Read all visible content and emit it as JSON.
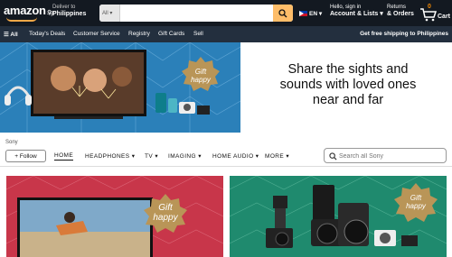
{
  "header": {
    "logo": "amazon",
    "logo_tld": ".sg",
    "deliver_label": "Deliver to",
    "deliver_location": "Philippines",
    "search_category": "All",
    "search_placeholder": "",
    "language": "EN",
    "account_greeting": "Hello, sign in",
    "account_label": "Account & Lists",
    "returns_label": "Returns",
    "orders_label": "& Orders",
    "cart_count": "0",
    "cart_label": "Cart"
  },
  "nav": {
    "all_label": "All",
    "items": [
      "Today's Deals",
      "Customer Service",
      "Registry",
      "Gift Cards",
      "Sell"
    ],
    "promo": "Get free shipping to Philippines"
  },
  "hero": {
    "headline_1": "Share the sights and",
    "headline_2": "sounds with loved ones",
    "headline_3": "near and far",
    "badge_1": "Gift",
    "badge_2": "happy"
  },
  "store": {
    "breadcrumb": "Sony",
    "follow_label": "+ Follow",
    "tabs": [
      "HOME",
      "HEADPHONES",
      "TV",
      "IMAGING",
      "HOME AUDIO",
      "MORE"
    ],
    "search_placeholder": "Search all Sony"
  },
  "tiles": {
    "tile1_badge_1": "Gift",
    "tile1_badge_2": "happy",
    "tile2_badge_1": "Gift",
    "tile2_badge_2": "happy"
  },
  "colors": {
    "topbar": "#131921",
    "navbar": "#232f3e",
    "search_button": "#febd69",
    "hero_blue": "#2b80b9",
    "tile_red": "#c8364a",
    "tile_green": "#1f8a6e",
    "gift_gold": "#b99557"
  }
}
